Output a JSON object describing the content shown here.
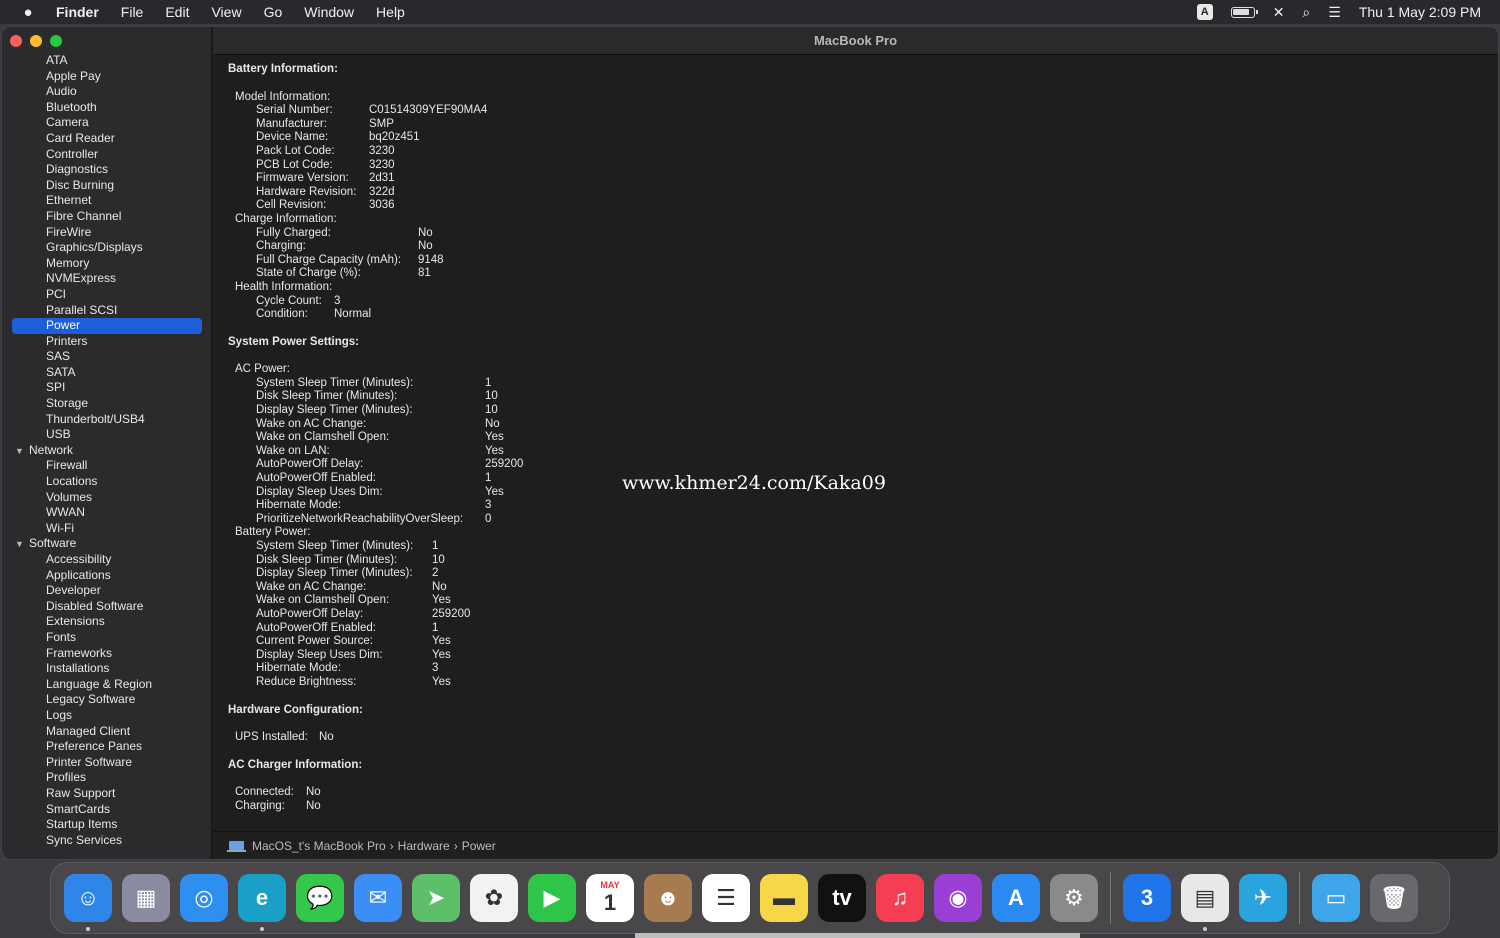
{
  "menubar": {
    "app": "Finder",
    "items": [
      "File",
      "Edit",
      "View",
      "Go",
      "Window",
      "Help"
    ],
    "input_source": "A",
    "datetime": "Thu 1 May  2:09 PM"
  },
  "window": {
    "title": "MacBook Pro"
  },
  "sidebar": [
    {
      "label": "ATA"
    },
    {
      "label": "Apple Pay"
    },
    {
      "label": "Audio"
    },
    {
      "label": "Bluetooth"
    },
    {
      "label": "Camera"
    },
    {
      "label": "Card Reader"
    },
    {
      "label": "Controller"
    },
    {
      "label": "Diagnostics"
    },
    {
      "label": "Disc Burning"
    },
    {
      "label": "Ethernet"
    },
    {
      "label": "Fibre Channel"
    },
    {
      "label": "FireWire"
    },
    {
      "label": "Graphics/Displays"
    },
    {
      "label": "Memory"
    },
    {
      "label": "NVMExpress"
    },
    {
      "label": "PCI"
    },
    {
      "label": "Parallel SCSI"
    },
    {
      "label": "Power",
      "selected": true
    },
    {
      "label": "Printers"
    },
    {
      "label": "SAS"
    },
    {
      "label": "SATA"
    },
    {
      "label": "SPI"
    },
    {
      "label": "Storage"
    },
    {
      "label": "Thunderbolt/USB4"
    },
    {
      "label": "USB"
    },
    {
      "label": "Network",
      "group": true
    },
    {
      "label": "Firewall"
    },
    {
      "label": "Locations"
    },
    {
      "label": "Volumes"
    },
    {
      "label": "WWAN"
    },
    {
      "label": "Wi-Fi"
    },
    {
      "label": "Software",
      "group": true
    },
    {
      "label": "Accessibility"
    },
    {
      "label": "Applications"
    },
    {
      "label": "Developer"
    },
    {
      "label": "Disabled Software"
    },
    {
      "label": "Extensions"
    },
    {
      "label": "Fonts"
    },
    {
      "label": "Frameworks"
    },
    {
      "label": "Installations"
    },
    {
      "label": "Language & Region"
    },
    {
      "label": "Legacy Software"
    },
    {
      "label": "Logs"
    },
    {
      "label": "Managed Client"
    },
    {
      "label": "Preference Panes"
    },
    {
      "label": "Printer Software"
    },
    {
      "label": "Profiles"
    },
    {
      "label": "Raw Support"
    },
    {
      "label": "SmartCards"
    },
    {
      "label": "Startup Items"
    },
    {
      "label": "Sync Services"
    }
  ],
  "content": [
    {
      "type": "section",
      "text": "Battery Information:"
    },
    {
      "type": "row",
      "level": 1,
      "key": "Model Information:",
      "value": ""
    },
    {
      "type": "row",
      "level": 2,
      "key": "Serial Number:",
      "value": "C01514309YEF90MA4",
      "kw": 113
    },
    {
      "type": "row",
      "level": 2,
      "key": "Manufacturer:",
      "value": "SMP",
      "kw": 113
    },
    {
      "type": "row",
      "level": 2,
      "key": "Device Name:",
      "value": "bq20z451",
      "kw": 113
    },
    {
      "type": "row",
      "level": 2,
      "key": "Pack Lot Code:",
      "value": "3230",
      "kw": 113
    },
    {
      "type": "row",
      "level": 2,
      "key": "PCB Lot Code:",
      "value": "3230",
      "kw": 113
    },
    {
      "type": "row",
      "level": 2,
      "key": "Firmware Version:",
      "value": "2d31",
      "kw": 113
    },
    {
      "type": "row",
      "level": 2,
      "key": "Hardware Revision:",
      "value": "322d",
      "kw": 113
    },
    {
      "type": "row",
      "level": 2,
      "key": "Cell Revision:",
      "value": "3036",
      "kw": 113
    },
    {
      "type": "row",
      "level": 1,
      "key": "Charge Information:",
      "value": ""
    },
    {
      "type": "row",
      "level": 2,
      "key": "Fully Charged:",
      "value": "No",
      "kw": 162
    },
    {
      "type": "row",
      "level": 2,
      "key": "Charging:",
      "value": "No",
      "kw": 162
    },
    {
      "type": "row",
      "level": 2,
      "key": "Full Charge Capacity (mAh):",
      "value": "9148",
      "kw": 162
    },
    {
      "type": "row",
      "level": 2,
      "key": "State of Charge (%):",
      "value": "81",
      "kw": 162
    },
    {
      "type": "row",
      "level": 1,
      "key": "Health Information:",
      "value": ""
    },
    {
      "type": "row",
      "level": 2,
      "key": "Cycle Count:",
      "value": "3",
      "kw": 78
    },
    {
      "type": "row",
      "level": 2,
      "key": "Condition:",
      "value": "Normal",
      "kw": 78
    },
    {
      "type": "section",
      "text": "System Power Settings:"
    },
    {
      "type": "row",
      "level": 1,
      "key": "AC Power:",
      "value": ""
    },
    {
      "type": "row",
      "level": 2,
      "key": "System Sleep Timer (Minutes):",
      "value": "1",
      "kw": 229
    },
    {
      "type": "row",
      "level": 2,
      "key": "Disk Sleep Timer (Minutes):",
      "value": "10",
      "kw": 229
    },
    {
      "type": "row",
      "level": 2,
      "key": "Display Sleep Timer (Minutes):",
      "value": "10",
      "kw": 229
    },
    {
      "type": "row",
      "level": 2,
      "key": "Wake on AC Change:",
      "value": "No",
      "kw": 229
    },
    {
      "type": "row",
      "level": 2,
      "key": "Wake on Clamshell Open:",
      "value": "Yes",
      "kw": 229
    },
    {
      "type": "row",
      "level": 2,
      "key": "Wake on LAN:",
      "value": "Yes",
      "kw": 229
    },
    {
      "type": "row",
      "level": 2,
      "key": "AutoPowerOff Delay:",
      "value": "259200",
      "kw": 229
    },
    {
      "type": "row",
      "level": 2,
      "key": "AutoPowerOff Enabled:",
      "value": "1",
      "kw": 229
    },
    {
      "type": "row",
      "level": 2,
      "key": "Display Sleep Uses Dim:",
      "value": "Yes",
      "kw": 229
    },
    {
      "type": "row",
      "level": 2,
      "key": "Hibernate Mode:",
      "value": "3",
      "kw": 229
    },
    {
      "type": "row",
      "level": 2,
      "key": "PrioritizeNetworkReachabilityOverSleep:",
      "value": "0",
      "kw": 229
    },
    {
      "type": "row",
      "level": 1,
      "key": "Battery Power:",
      "value": ""
    },
    {
      "type": "row",
      "level": 2,
      "key": "System Sleep Timer (Minutes):",
      "value": "1",
      "kw": 176
    },
    {
      "type": "row",
      "level": 2,
      "key": "Disk Sleep Timer (Minutes):",
      "value": "10",
      "kw": 176
    },
    {
      "type": "row",
      "level": 2,
      "key": "Display Sleep Timer (Minutes):",
      "value": "2",
      "kw": 176
    },
    {
      "type": "row",
      "level": 2,
      "key": "Wake on AC Change:",
      "value": "No",
      "kw": 176
    },
    {
      "type": "row",
      "level": 2,
      "key": "Wake on Clamshell Open:",
      "value": "Yes",
      "kw": 176
    },
    {
      "type": "row",
      "level": 2,
      "key": "AutoPowerOff Delay:",
      "value": "259200",
      "kw": 176
    },
    {
      "type": "row",
      "level": 2,
      "key": "AutoPowerOff Enabled:",
      "value": "1",
      "kw": 176
    },
    {
      "type": "row",
      "level": 2,
      "key": "Current Power Source:",
      "value": "Yes",
      "kw": 176
    },
    {
      "type": "row",
      "level": 2,
      "key": "Display Sleep Uses Dim:",
      "value": "Yes",
      "kw": 176
    },
    {
      "type": "row",
      "level": 2,
      "key": "Hibernate Mode:",
      "value": "3",
      "kw": 176
    },
    {
      "type": "row",
      "level": 2,
      "key": "Reduce Brightness:",
      "value": "Yes",
      "kw": 176
    },
    {
      "type": "section",
      "text": "Hardware Configuration:"
    },
    {
      "type": "row",
      "level": 1,
      "key": "UPS Installed:",
      "value": "No",
      "kw": 84
    },
    {
      "type": "section",
      "text": "AC Charger Information:"
    },
    {
      "type": "row",
      "level": 1,
      "key": "Connected:",
      "value": "No",
      "kw": 71
    },
    {
      "type": "row",
      "level": 1,
      "key": "Charging:",
      "value": "No",
      "kw": 71
    }
  ],
  "breadcrumb": [
    "MacOS_t's MacBook Pro",
    "Hardware",
    "Power"
  ],
  "watermark": "www.khmer24.com/Kaka09",
  "dock": [
    {
      "name": "finder",
      "glyph": "☺",
      "bg": "#2f86e8",
      "running": true
    },
    {
      "name": "launchpad",
      "glyph": "▦",
      "bg": "#8a8aa0"
    },
    {
      "name": "safari",
      "glyph": "◎",
      "bg": "#2d8ff0"
    },
    {
      "name": "edge",
      "glyph": "e",
      "bg": "#1aa0c8",
      "running": true
    },
    {
      "name": "messages",
      "glyph": "💬",
      "bg": "#33c84a"
    },
    {
      "name": "mail",
      "glyph": "✉",
      "bg": "#3b8ef5"
    },
    {
      "name": "maps",
      "glyph": "➤",
      "bg": "#5dbf6a"
    },
    {
      "name": "photos",
      "glyph": "✿",
      "bg": "#f2f2f2"
    },
    {
      "name": "facetime",
      "glyph": "▶",
      "bg": "#2fc548"
    },
    {
      "name": "calendar",
      "glyph": "1",
      "bg": "#ffffff",
      "label": "MAY"
    },
    {
      "name": "contacts",
      "glyph": "☻",
      "bg": "#a77b4f"
    },
    {
      "name": "reminders",
      "glyph": "☰",
      "bg": "#ffffff"
    },
    {
      "name": "notes",
      "glyph": "▬",
      "bg": "#f7d64a"
    },
    {
      "name": "apple-tv",
      "glyph": "tv",
      "bg": "#111111"
    },
    {
      "name": "music",
      "glyph": "♫",
      "bg": "#f53d54"
    },
    {
      "name": "podcasts",
      "glyph": "◉",
      "bg": "#9a3fd6"
    },
    {
      "name": "app-store",
      "glyph": "A",
      "bg": "#2b8bf3"
    },
    {
      "name": "system-settings",
      "glyph": "⚙",
      "bg": "#8a8a8a"
    },
    {
      "sep": true
    },
    {
      "name": "3utools",
      "glyph": "3",
      "bg": "#1e74e8"
    },
    {
      "name": "system-information",
      "glyph": "▤",
      "bg": "#e8e8e8",
      "running": true
    },
    {
      "name": "telegram",
      "glyph": "✈",
      "bg": "#2aa3df"
    },
    {
      "sep": true
    },
    {
      "name": "downloads-folder",
      "glyph": "▭",
      "bg": "#3ea6e8"
    },
    {
      "name": "trash",
      "glyph": "🗑",
      "bg": "#6a686c"
    }
  ]
}
